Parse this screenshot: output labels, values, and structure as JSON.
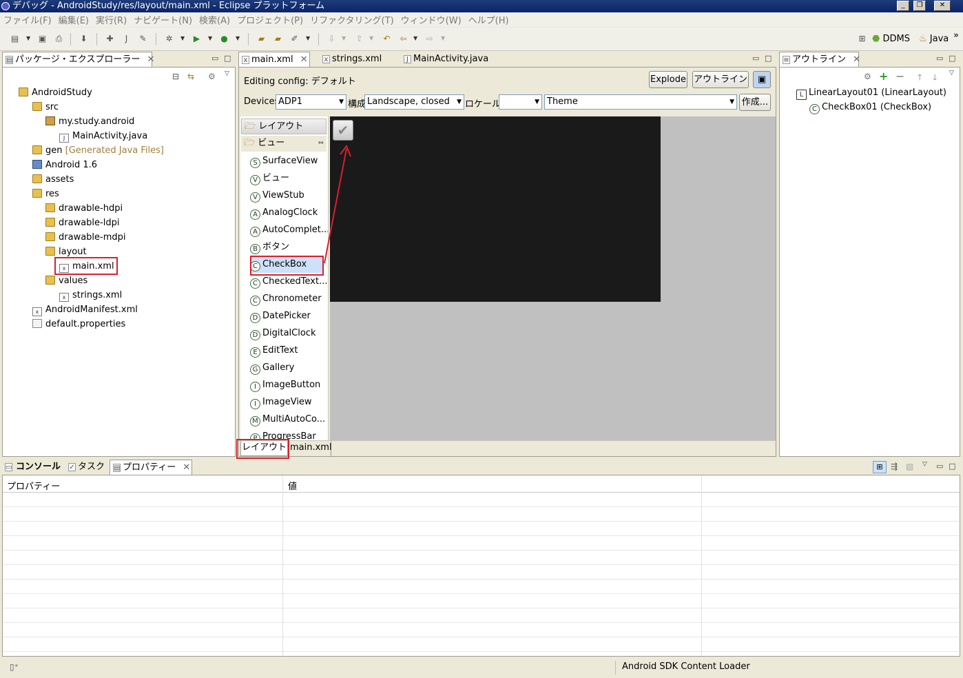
{
  "window": {
    "title": "デバッグ - AndroidStudy/res/layout/main.xml - Eclipse プラットフォーム",
    "controls": [
      "_",
      "❐",
      "✕"
    ]
  },
  "menu": [
    "ファイル(F)",
    "編集(E)",
    "実行(R)",
    "ナビゲート(N)",
    "検索(A)",
    "プロジェクト(P)",
    "リファクタリング(T)",
    "ウィンドウ(W)",
    "ヘルプ(H)"
  ],
  "perspectives": {
    "ddms": "DDMS",
    "java": "Java",
    "more": "»"
  },
  "package_explorer": {
    "tab_label": "パッケージ・エクスプローラー",
    "tree": [
      {
        "label": "AndroidStudy",
        "icon": "project-icon"
      },
      {
        "label": "src",
        "icon": "folder-icon"
      },
      {
        "label": "my.study.android",
        "icon": "package-icon"
      },
      {
        "label": "MainActivity.java",
        "icon": "java-file-icon"
      },
      {
        "label": "gen",
        "extra": "[Generated Java Files]",
        "icon": "folder-icon"
      },
      {
        "label": "Android 1.6",
        "icon": "library-icon"
      },
      {
        "label": "assets",
        "icon": "folder-icon"
      },
      {
        "label": "res",
        "icon": "folder-icon"
      },
      {
        "label": "drawable-hdpi",
        "icon": "folder-icon"
      },
      {
        "label": "drawable-ldpi",
        "icon": "folder-icon"
      },
      {
        "label": "drawable-mdpi",
        "icon": "folder-icon"
      },
      {
        "label": "layout",
        "icon": "folder-icon"
      },
      {
        "label": "main.xml",
        "icon": "xml-file-icon"
      },
      {
        "label": "values",
        "icon": "folder-icon"
      },
      {
        "label": "strings.xml",
        "icon": "xml-file-icon"
      },
      {
        "label": "AndroidManifest.xml",
        "icon": "xml-file-icon"
      },
      {
        "label": "default.properties",
        "icon": "properties-file-icon"
      }
    ]
  },
  "editor": {
    "tabs": [
      "main.xml",
      "strings.xml",
      "MainActivity.java"
    ],
    "config_label": "Editing config: デフォルト",
    "explode_label": "Explode",
    "outline_label": "アウトライン",
    "devices_label": "Devices",
    "device_value": "ADP1",
    "config_label2": "構成",
    "config_value": "Landscape, closed",
    "locale_label": "ロケール",
    "locale_value": "",
    "theme_value": "Theme",
    "create_label": "作成...",
    "palette_sections": [
      "レイアウト",
      "ビュー"
    ],
    "palette_items": [
      {
        "glyph": "S",
        "label": "SurfaceView"
      },
      {
        "glyph": "V",
        "label": "ビュー"
      },
      {
        "glyph": "V",
        "label": "ViewStub"
      },
      {
        "glyph": "A",
        "label": "AnalogClock"
      },
      {
        "glyph": "A",
        "label": "AutoComplet..."
      },
      {
        "glyph": "B",
        "label": "ボタン"
      },
      {
        "glyph": "C",
        "label": "CheckBox"
      },
      {
        "glyph": "C",
        "label": "CheckedText..."
      },
      {
        "glyph": "C",
        "label": "Chronometer"
      },
      {
        "glyph": "D",
        "label": "DatePicker"
      },
      {
        "glyph": "D",
        "label": "DigitalClock"
      },
      {
        "glyph": "E",
        "label": "EditText"
      },
      {
        "glyph": "G",
        "label": "Gallery"
      },
      {
        "glyph": "I",
        "label": "ImageButton"
      },
      {
        "glyph": "I",
        "label": "ImageView"
      },
      {
        "glyph": "M",
        "label": "MultiAutoCo..."
      },
      {
        "glyph": "P",
        "label": "ProgressBar"
      }
    ],
    "bottom_tabs": [
      "レイアウト",
      "main.xml"
    ]
  },
  "outline": {
    "tab_label": "アウトライン",
    "items": [
      {
        "glyph": "L",
        "label": "LinearLayout01 (LinearLayout)"
      },
      {
        "glyph": "C",
        "label": "CheckBox01 (CheckBox)"
      }
    ]
  },
  "bottom_panel": {
    "tabs": [
      "コンソール",
      "タスク",
      "プロパティー"
    ],
    "columns": [
      "プロパティー",
      "値"
    ]
  },
  "status": {
    "loader_text": "Android SDK Content Loader"
  },
  "colors": {
    "highlight_red": "#d8202c",
    "selection_blue": "#cde2f9",
    "canvas_dark": "#1a1a1a",
    "canvas_gray": "#c0c0c0"
  }
}
